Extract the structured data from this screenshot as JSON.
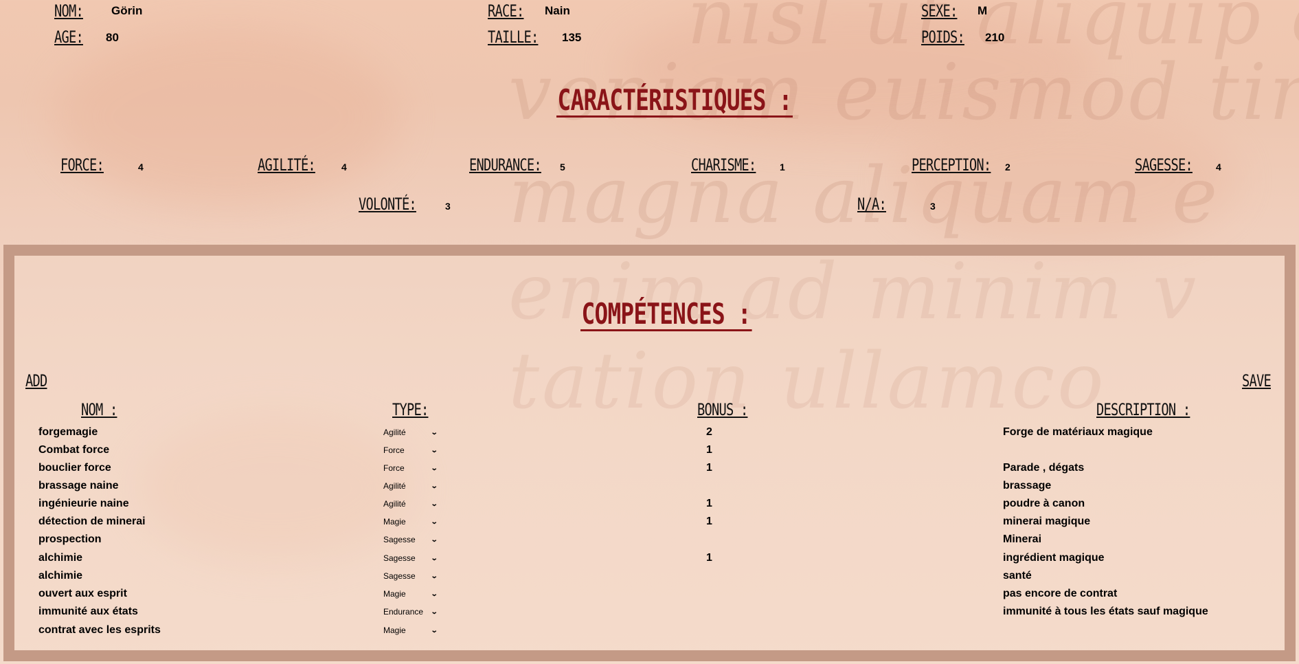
{
  "identity": {
    "nom_label": "NOM:",
    "nom": "Görin",
    "race_label": "RACE:",
    "race": "Nain",
    "sexe_label": "SEXE:",
    "sexe": "M",
    "age_label": "AGE:",
    "age": "80",
    "taille_label": "TAILLE:",
    "taille": "135",
    "poids_label": "POIDS:",
    "poids": "210"
  },
  "caracteristiques": {
    "title": "CARACTÉRISTIQUES :",
    "stats": [
      {
        "label": "FORCE:",
        "value": "4"
      },
      {
        "label": "AGILITÉ:",
        "value": "4"
      },
      {
        "label": "ENDURANCE:",
        "value": "5"
      },
      {
        "label": "CHARISME:",
        "value": "1"
      },
      {
        "label": "PERCEPTION:",
        "value": "2"
      },
      {
        "label": "SAGESSE:",
        "value": "4"
      },
      {
        "label": "VOLONTÉ:",
        "value": "3"
      },
      {
        "label": "N/A:",
        "value": "3"
      }
    ]
  },
  "competences": {
    "title": "COMPÉTENCES :",
    "add_label": "ADD",
    "save_label": "SAVE",
    "headers": {
      "nom": "NOM :",
      "type": "TYPE:",
      "bonus": "BONUS :",
      "description": "DESCRIPTION :"
    },
    "rows": [
      {
        "nom": "forgemagie",
        "type": "Agilité",
        "bonus": "2",
        "description": "Forge de matériaux magique"
      },
      {
        "nom": "Combat force",
        "type": "Force",
        "bonus": "1",
        "description": ""
      },
      {
        "nom": "bouclier force",
        "type": "Force",
        "bonus": "1",
        "description": "Parade , dégats"
      },
      {
        "nom": "brassage naine",
        "type": "Agilité",
        "bonus": "",
        "description": "brassage"
      },
      {
        "nom": "ingénieurie naine",
        "type": "Agilité",
        "bonus": "1",
        "description": "poudre à canon"
      },
      {
        "nom": "détection de minerai",
        "type": "Magie",
        "bonus": "1",
        "description": "minerai magique"
      },
      {
        "nom": "prospection",
        "type": "Sagesse",
        "bonus": "",
        "description": "Minerai"
      },
      {
        "nom": "alchimie",
        "type": "Sagesse",
        "bonus": "1",
        "description": "ingrédient magique"
      },
      {
        "nom": "alchimie",
        "type": "Sagesse",
        "bonus": "",
        "description": "santé"
      },
      {
        "nom": "ouvert aux esprit",
        "type": "Magie",
        "bonus": "",
        "description": "pas encore de contrat"
      },
      {
        "nom": "immunité aux états",
        "type": "Endurance",
        "bonus": "",
        "description": "immunité à tous les états sauf magique"
      },
      {
        "nom": "contrat avec les esprits",
        "type": "Magie",
        "bonus": "",
        "description": ""
      }
    ]
  },
  "watermark": [
    "nisl ut aliquip ex ea",
    "veniam euismod tin",
    "magna aliquam e",
    "enim ad minim v",
    "tation ullamco"
  ],
  "colors": {
    "title_red": "#8a1418",
    "panel_border": "#c49a86",
    "parchment": "#f1d3c2"
  }
}
